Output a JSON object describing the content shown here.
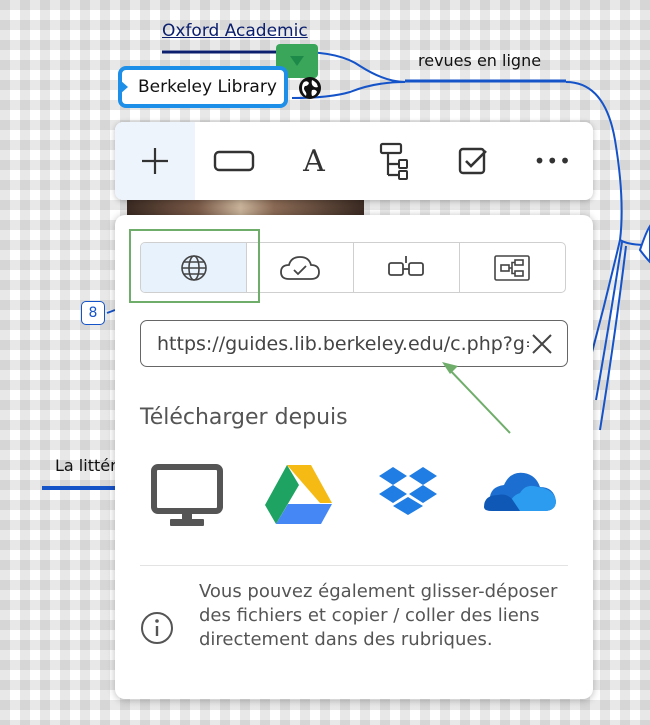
{
  "mindmap": {
    "nodes": {
      "oxford": "Oxford Academic",
      "revues": "revues en ligne",
      "berkeley": "Berkeley Library",
      "litte": "La littérature",
      "badge_count": "8"
    },
    "line_color": "#1553c9",
    "selected_color": "#1e8fe8"
  },
  "toolbar": {
    "tools": [
      {
        "name": "add",
        "icon": "plus-icon"
      },
      {
        "name": "shape",
        "icon": "rectangle-icon"
      },
      {
        "name": "text",
        "icon": "text-icon",
        "glyph": "A"
      },
      {
        "name": "structure",
        "icon": "tree-structure-icon"
      },
      {
        "name": "task",
        "icon": "checkbox-icon"
      },
      {
        "name": "more",
        "icon": "more-icon",
        "glyph": "•••"
      }
    ]
  },
  "attach_panel": {
    "tabs": [
      {
        "name": "web-link",
        "icon": "globe-icon",
        "active": true
      },
      {
        "name": "cloud",
        "icon": "cloud-check-icon",
        "active": false
      },
      {
        "name": "link-topic",
        "icon": "linked-nodes-icon",
        "active": false
      },
      {
        "name": "embed-map",
        "icon": "mindmap-embed-icon",
        "active": false
      }
    ],
    "url_value": "https://guides.lib.berkeley.edu/c.php?g=",
    "upload_title": "Télécharger depuis",
    "sources": [
      {
        "name": "computer",
        "icon": "monitor-icon"
      },
      {
        "name": "google-drive",
        "icon": "google-drive-icon"
      },
      {
        "name": "dropbox",
        "icon": "dropbox-icon"
      },
      {
        "name": "onedrive",
        "icon": "onedrive-icon"
      }
    ],
    "info_text": "Vous pouvez également glisser-déposer des fichiers et copier / coller des liens directement dans des rubriques."
  },
  "annotation_color": "#6fae6a"
}
